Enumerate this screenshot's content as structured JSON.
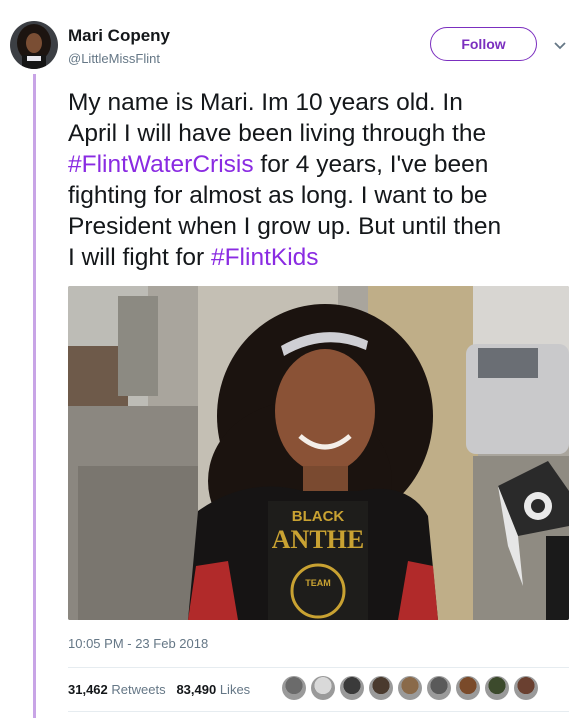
{
  "user": {
    "display_name": "Mari Copeny",
    "handle": "@LittleMissFlint"
  },
  "follow_button": {
    "label": "Follow"
  },
  "tweet": {
    "lines": [
      [
        {
          "text": "My name is Mari. Im 10 years old. In",
          "hashtag": false
        }
      ],
      [
        {
          "text": "April I will have been living through the",
          "hashtag": false
        }
      ],
      [
        {
          "text": "#FlintWaterCrisis",
          "hashtag": true
        },
        {
          "text": " for 4 years, I've been",
          "hashtag": false
        }
      ],
      [
        {
          "text": "fighting for almost as long. I want to be",
          "hashtag": false
        }
      ],
      [
        {
          "text": "President when I grow up. But until then",
          "hashtag": false
        }
      ],
      [
        {
          "text": "I will fight for ",
          "hashtag": false
        },
        {
          "text": "#FlintKids",
          "hashtag": true
        }
      ]
    ],
    "photo_shirt_text": [
      "BLACK",
      "ANTHE",
      "TEAM"
    ],
    "timestamp": "10:05 PM - 23 Feb 2018"
  },
  "stats": {
    "retweets_count": "31,462",
    "retweets_label": "Retweets",
    "likes_count": "83,490",
    "likes_label": "Likes"
  },
  "likers": [
    "#6b6b6b",
    "#d9d9d9",
    "#3a3a3a",
    "#4a3a2e",
    "#8a6a4a",
    "#5a5a5a",
    "#7a4a2a",
    "#3c4a2c",
    "#6a4030"
  ],
  "colors": {
    "accent": "#7b2fbf",
    "hashtag": "#8a2be2",
    "thread_line": "#c8a4e6",
    "muted": "#657786"
  },
  "icons": {
    "caret": "chevron-down-icon"
  }
}
